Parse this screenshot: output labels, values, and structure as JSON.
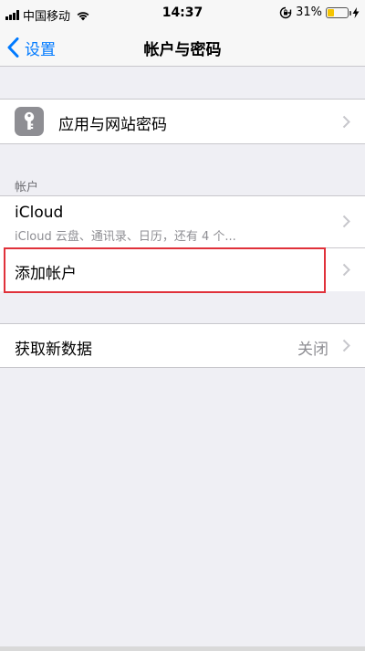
{
  "status_bar": {
    "carrier": "中国移动",
    "time": "14:37",
    "battery_percent": "31%",
    "battery_level": 0.31,
    "battery_color": "#f5c400"
  },
  "nav": {
    "back_label": "设置",
    "title": "帐户与密码"
  },
  "passwords_cell": {
    "label": "应用与网站密码",
    "icon": "key-icon"
  },
  "accounts_section": {
    "header": "帐户",
    "items": [
      {
        "label": "iCloud",
        "subtitle": "iCloud 云盘、通讯录、日历，还有 4 个..."
      },
      {
        "label": "添加帐户"
      }
    ]
  },
  "fetch_cell": {
    "label": "获取新数据",
    "value": "关闭"
  },
  "colors": {
    "accent": "#007aff",
    "highlight_border": "#e0313a",
    "background": "#efeff4"
  }
}
